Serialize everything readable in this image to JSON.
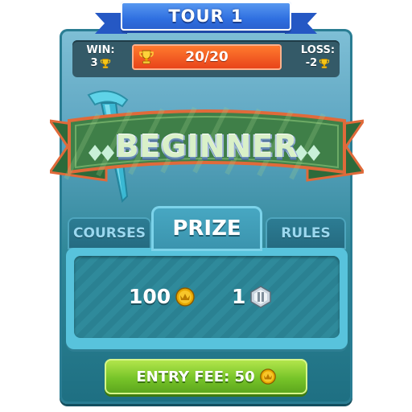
{
  "header": {
    "title": "TOUR 1"
  },
  "stats": {
    "win_label": "WIN:",
    "win_value": "3",
    "loss_label": "LOSS:",
    "loss_value": "-2",
    "progress_text": "20/20",
    "progress_fraction": 1.0
  },
  "banner": {
    "title": "BEGINNER"
  },
  "tabs": [
    {
      "label": "COURSES",
      "active": false
    },
    {
      "label": "PRIZE",
      "active": true
    },
    {
      "label": "RULES",
      "active": false
    }
  ],
  "prizes": [
    {
      "value": "100",
      "icon": "coin-icon"
    },
    {
      "value": "1",
      "icon": "gem-icon"
    }
  ],
  "entry_button": {
    "label": "ENTRY FEE: 50",
    "icon": "coin-icon"
  },
  "colors": {
    "header_blue": "#2f6fe0",
    "progress_orange": "#e84a1f",
    "button_green": "#77c429",
    "panel_teal": "#2f8a9b"
  }
}
